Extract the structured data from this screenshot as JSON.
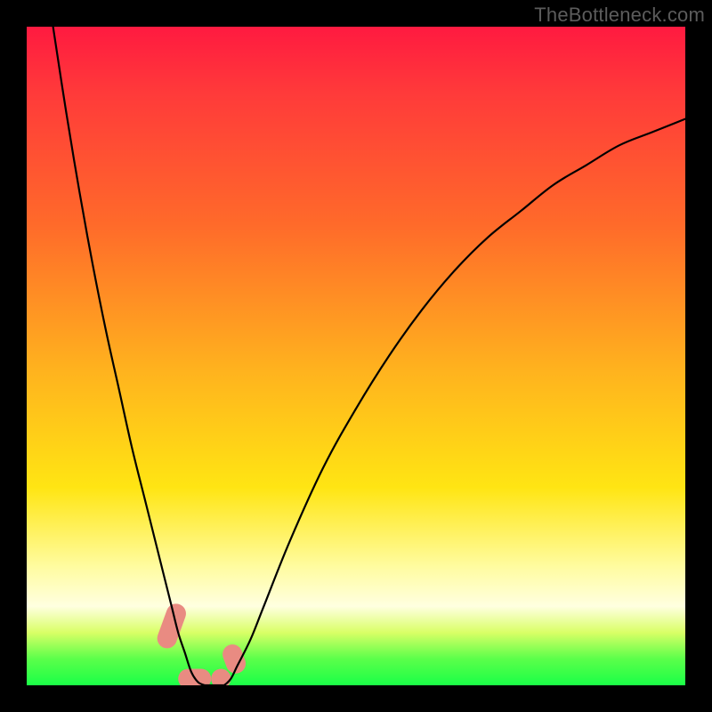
{
  "watermark": "TheBottleneck.com",
  "chart_data": {
    "type": "line",
    "title": "",
    "xlabel": "",
    "ylabel": "",
    "xlim": [
      0,
      100
    ],
    "ylim": [
      0,
      100
    ],
    "grid": false,
    "legend": false,
    "annotations": [],
    "background_gradient": {
      "direction": "top-to-bottom",
      "stops": [
        {
          "pos": 0.0,
          "color": "#ff1a40"
        },
        {
          "pos": 0.1,
          "color": "#ff3a3a"
        },
        {
          "pos": 0.3,
          "color": "#ff6a2a"
        },
        {
          "pos": 0.52,
          "color": "#ffb21e"
        },
        {
          "pos": 0.7,
          "color": "#ffe513"
        },
        {
          "pos": 0.82,
          "color": "#fffca0"
        },
        {
          "pos": 0.88,
          "color": "#ffffe0"
        },
        {
          "pos": 0.92,
          "color": "#d9ff66"
        },
        {
          "pos": 0.96,
          "color": "#5bff4a"
        },
        {
          "pos": 1.0,
          "color": "#1aff47"
        }
      ]
    },
    "series": [
      {
        "name": "left-branch",
        "color": "#000000",
        "x": [
          4,
          6,
          8,
          10,
          12,
          14,
          16,
          18,
          20,
          21,
          22,
          23,
          24,
          25,
          26,
          27
        ],
        "y": [
          100,
          87,
          75,
          64,
          54,
          45,
          36,
          28,
          20,
          16,
          12,
          8,
          5,
          2,
          0.5,
          0
        ]
      },
      {
        "name": "right-branch",
        "color": "#000000",
        "x": [
          30,
          31,
          32,
          34,
          36,
          40,
          45,
          50,
          55,
          60,
          65,
          70,
          75,
          80,
          85,
          90,
          95,
          100
        ],
        "y": [
          0,
          1,
          3,
          7,
          12,
          22,
          33,
          42,
          50,
          57,
          63,
          68,
          72,
          76,
          79,
          82,
          84,
          86
        ]
      },
      {
        "name": "valley-floor",
        "color": "#000000",
        "x": [
          27,
          28,
          29,
          30
        ],
        "y": [
          0,
          0,
          0,
          0
        ]
      }
    ],
    "markers": [
      {
        "name": "left-top-blob",
        "color": "#e98b82",
        "shape": "round-rect",
        "x": 22.0,
        "y": 9.0,
        "w": 3.0,
        "h": 7.0,
        "rot": 20
      },
      {
        "name": "left-end-blob",
        "color": "#e98b82",
        "shape": "round-rect",
        "x": 25.5,
        "y": 1.0,
        "w": 5.0,
        "h": 3.0,
        "rot": 0
      },
      {
        "name": "right-end-blob",
        "color": "#e98b82",
        "shape": "round-rect",
        "x": 29.5,
        "y": 1.0,
        "w": 3.0,
        "h": 3.0,
        "rot": 0
      },
      {
        "name": "right-start-blob",
        "color": "#e98b82",
        "shape": "round-rect",
        "x": 31.5,
        "y": 4.0,
        "w": 3.0,
        "h": 4.5,
        "rot": -20
      }
    ]
  }
}
